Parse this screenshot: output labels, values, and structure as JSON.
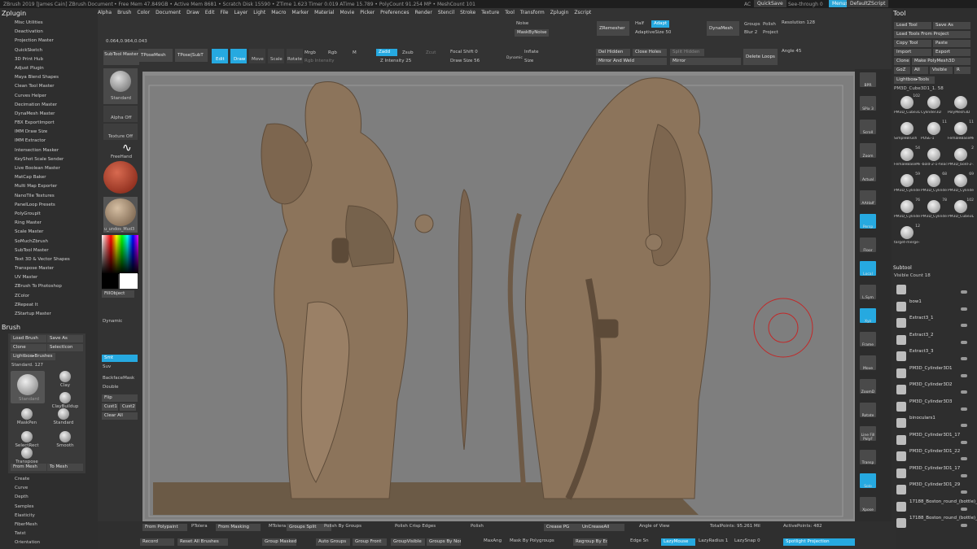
{
  "topbar": {
    "title": "ZBrush 2019 [James Cain]  ZBrush Document",
    "stats": "• Free Mem 47.849GB • Active Mem 8681 • Scratch Disk 15590 • ZTime 1.623 Timer 0.019 ATime 15.789 • PolyCount 91.254 MP • MeshCount 101",
    "ac": "AC",
    "quicksave": "QuickSave",
    "seethrough": "See-through 0",
    "menus": "Menus",
    "defaultzscript": "DefaultZScript"
  },
  "menu": [
    "Alpha",
    "Brush",
    "Color",
    "Document",
    "Draw",
    "Edit",
    "File",
    "Layer",
    "Light",
    "Macro",
    "Marker",
    "Material",
    "Movie",
    "Picker",
    "Preferences",
    "Render",
    "Stencil",
    "Stroke",
    "Texture",
    "Tool",
    "Transform",
    "Zplugin",
    "Zscript"
  ],
  "zplugin": {
    "title": "Zplugin",
    "items": [
      "Misc Utilities",
      "Deactivation",
      "Projection Master",
      "QuickSketch",
      "3D Print Hub",
      "Adjust Plugin",
      "Maya Blend Shapes",
      "Clean Tool Master",
      "Curves Helper",
      "Decimation Master",
      "DynaMesh Master",
      "FBX ExportImport",
      "IMM Draw Size",
      "IMM Extractor",
      "Intersection Masker",
      "KeyShot Scale Sender",
      "Live Boolean Master",
      "MatCap Baker",
      "Multi Map Exporter",
      "NanoTile Textures",
      "PanelLoop Presets",
      "PolyGroupIt",
      "Ring Master",
      "Scale Master",
      "SoMuchZbrush",
      "SubTool Master",
      "Text 3D & Vector Shapes",
      "Transpose Master",
      "UV Master",
      "ZBrush To Photoshop",
      "ZColor",
      "ZRepeat It",
      "ZStartup Master"
    ]
  },
  "brushpanel": {
    "title": "Brush",
    "load": "Load Brush",
    "save": "Save As",
    "clone": "Clone",
    "selecticon": "SelectIcon",
    "lightbox": "Lightbox▸Brushes",
    "standard": "Standard. 127",
    "brushes": [
      "Standard",
      "Clay",
      "ClayBuildup",
      "MaskPen",
      "Standard",
      "SelectRect",
      "Smooth",
      "Transpose"
    ],
    "frommesh": "From Mesh",
    "tomesh": "To Mesh",
    "bottom": [
      "Create",
      "Curve",
      "Depth",
      "Samples",
      "Elasticity",
      "FiberMesh",
      "Twist",
      "Orientation"
    ]
  },
  "shelf": {
    "subtool_master": "SubTool Master",
    "standard": "Standard",
    "alpha_off": "Alpha Off",
    "texture_off": "Texture Off",
    "freehand": "FreeHand",
    "material": "u_undos_Mud3",
    "fillobject": "FillObject",
    "dynamic": "Dynamic",
    "smt": "Smt",
    "suv": "Suv",
    "backfacemask": "BackfaceMask",
    "double": "Double",
    "flip": "Flip",
    "cust1": "Cust1",
    "cust2": "Cust2",
    "clearall": "Clear All"
  },
  "topshelf": {
    "coords": "0.064,0.964,0.043",
    "noise": "Noise",
    "maskbynoise": "MaskByNoise",
    "zremesher": "ZRemesher",
    "half": "Half",
    "adapt": "Adapt",
    "adaptivesize": "AdaptiveSize 50",
    "dynamesh": "DynaMesh",
    "groups": "Groups",
    "polish": "Polish",
    "blur": "Blur 2",
    "project": "Project",
    "resolution": "Resolution 128",
    "tposemesh": "TPoseMesh",
    "tposesubt": "TPose|SubT",
    "edit": "Edit",
    "draw": "Draw",
    "move": "Move",
    "scale": "Scale",
    "rotate": "Rotate",
    "mrgb": "Mrgb",
    "rgb": "Rgb",
    "m": "M",
    "zadd": "Zadd",
    "zsub": "Zsub",
    "zcut": "Zcut",
    "focalshift": "Focal Shift 0",
    "drawsize": "Draw Size 56",
    "dynamic": "Dynamic",
    "zintensity": "Z Intensity 25",
    "rgbintensity": "Rgb Intensity",
    "inflate": "Inflate",
    "size": "Size",
    "delhidden": "Del Hidden",
    "closeholes": "Close Holes",
    "splithidden": "Split Hidden",
    "mirrorweld": "Mirror And Weld",
    "mirror": "Mirror",
    "deleteloops": "Delete Loops",
    "angle": "Angle 45"
  },
  "rshelf": [
    "BPR",
    "SPix 3",
    "Scroll",
    "Zoom",
    "Actual",
    "AAHalf",
    "Persp",
    "Floor",
    "Local",
    "L.Sym",
    "Xyz",
    "Frame",
    "Move",
    "ZoomD",
    "Rotate",
    "Line Fill PolyF",
    "Transp",
    "Solo",
    "Xpose"
  ],
  "tool": {
    "title": "Tool",
    "loadtool": "Load Tool",
    "saveas": "Save As",
    "loadproject": "Load Tools From Project",
    "copytool": "Copy Tool",
    "paste": "Paste",
    "import": "Import",
    "export": "Export",
    "clone": "Clone",
    "makepoly": "Make PolyMesh3D",
    "goz": "GoZ",
    "all": "All",
    "visible": "Visible",
    "r": "R",
    "lightbox": "Lightbox▸Tools",
    "current": "PM3D_Cube3D1_1. 58",
    "thumbs": [
      {
        "n": "PM3D_Cube3D",
        "c": "102"
      },
      {
        "n": "Cylinder3D",
        "c": ""
      },
      {
        "n": "PolyMesh3D",
        "c": ""
      },
      {
        "n": "SimpleBrush",
        "c": ""
      },
      {
        "n": "POSE-1",
        "c": "11"
      },
      {
        "n": "FemaleBaseMes",
        "c": "11"
      },
      {
        "n": "FemaleBaseMes",
        "c": "54"
      },
      {
        "n": "-bold-2-1-head",
        "c": ""
      },
      {
        "n": "PM3D_bold-2-1-",
        "c": "2"
      },
      {
        "n": "PM3D_Cylinder3",
        "c": "59"
      },
      {
        "n": "PM3D_Cylinder3",
        "c": "68"
      },
      {
        "n": "PM3D_Cylinder3",
        "c": "69"
      },
      {
        "n": "PM3D_Cylinder3",
        "c": "76"
      },
      {
        "n": "PM3D_Cylinder3",
        "c": "78"
      },
      {
        "n": "PM3D_Cube3D1",
        "c": "102"
      },
      {
        "n": "target-merge-2",
        "c": "12"
      }
    ]
  },
  "subtool": {
    "title": "Subtool",
    "visiblecount": "Visible Count 18",
    "items": [
      "",
      "bow1",
      "Extract3_1",
      "Extract3_2",
      "Extract3_3",
      "PM3D_Cylinder3D1",
      "PM3D_Cylinder3D2",
      "PM3D_Cylinder3D3",
      "binoculars1",
      "PM3D_Cylinder3D1_17",
      "PM3D_Cylinder3D1_22",
      "PM3D_Cylinder3D1_17",
      "PM3D_Cylinder3D1_29",
      "17188_Boston_round_(bottle)_v",
      "17188_Boston_round_(bottle)_v"
    ]
  },
  "bottom": {
    "row1": [
      "From Polypaint",
      "PTolera",
      "From Masking",
      "MTolera",
      "Groups Split",
      "Polish By Groups",
      "Polish Crisp Edges",
      "Polish",
      "Crease PG",
      "UnCreaseAll",
      "Angle of View",
      "TotalPoints: 95.261 Mil",
      "ActivePoints: 482"
    ],
    "row2": [
      "Record",
      "Reset All Brushes",
      "Group Masked",
      "Auto Groups",
      "Group Front",
      "GroupVisible",
      "Groups By Normals",
      "MaxAng",
      "Mask By Polygroups",
      "Regroup By Edges",
      "Edge Sn",
      "LazyMouse",
      "LazyRadius 1",
      "LazySnap 0",
      "Spotlight Projection"
    ]
  }
}
